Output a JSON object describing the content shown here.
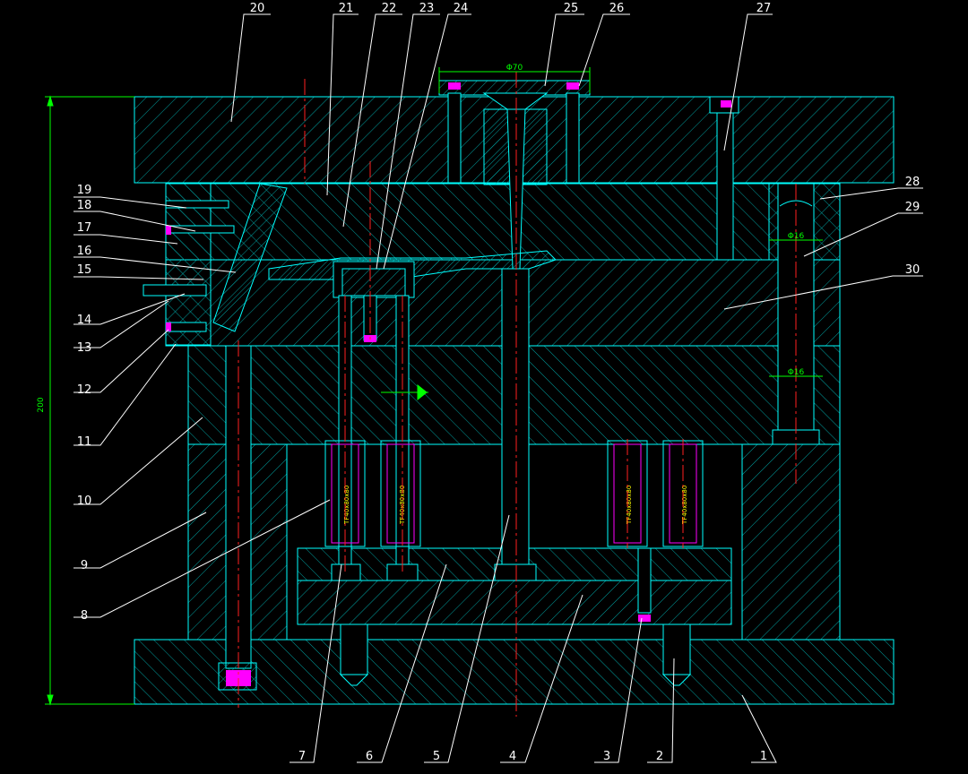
{
  "drawing": {
    "overall_height_dim": "200",
    "sprue_diameter_dim": "Φ70",
    "guide_pin_dim_upper": "Φ16",
    "guide_pin_dim_lower": "Φ16",
    "spring_label": "TF40x80x80"
  },
  "balloons": {
    "top": [
      "20",
      "21",
      "22",
      "23",
      "24",
      "25",
      "26",
      "27"
    ],
    "right": [
      "28",
      "29",
      "30"
    ],
    "left": [
      "19",
      "18",
      "17",
      "16",
      "15",
      "14",
      "13",
      "12",
      "11",
      "10",
      "9",
      "8"
    ],
    "bottom": [
      "7",
      "6",
      "5",
      "4",
      "3",
      "2",
      "1"
    ]
  },
  "colors": {
    "background": "#000000",
    "outline": "#00ffff",
    "hatch": "#00a0a0",
    "centerline": "#ff2020",
    "leader": "#ffffff",
    "dimension": "#00ff00",
    "fastener": "#ff00ff",
    "spring_text": "#ffff00"
  }
}
